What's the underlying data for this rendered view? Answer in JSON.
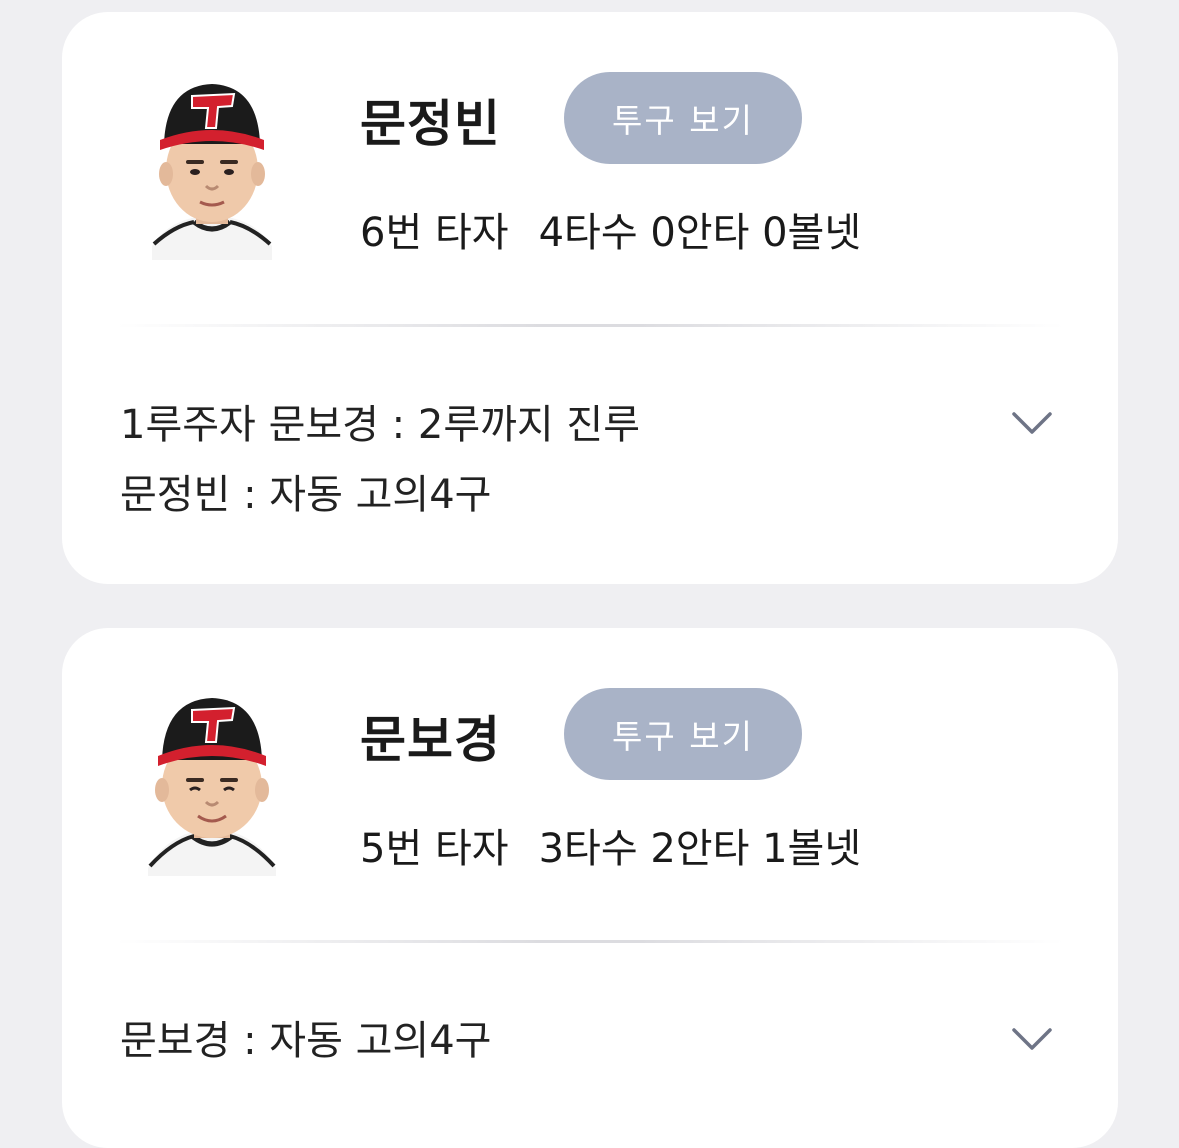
{
  "cards": [
    {
      "name": "문정빈",
      "pitch_button": "투구 보기",
      "batting_order": "6번 타자",
      "stats": "4타수 0안타 0볼넷",
      "events": [
        "1루주자 문보경 : 2루까지 진루",
        "문정빈 : 자동 고의4구"
      ],
      "expand_icon": "chevron-down-icon"
    },
    {
      "name": "문보경",
      "pitch_button": "투구 보기",
      "batting_order": "5번 타자",
      "stats": "3타수 2안타 1볼넷",
      "events": [
        "문보경 : 자동 고의4구"
      ],
      "expand_icon": "chevron-down-icon"
    }
  ],
  "colors": {
    "background": "#efeff2",
    "card": "#ffffff",
    "button": "#a9b3c7",
    "cap": "#1b1b1b",
    "cap_logo": "#d3202e",
    "chevron": "#6e7486"
  }
}
